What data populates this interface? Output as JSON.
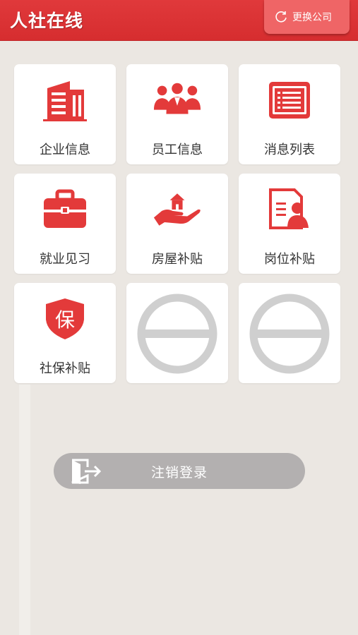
{
  "header": {
    "title": "人社在线",
    "switch_company_label": "更换公司",
    "accent_color": "#d8302f"
  },
  "grid": {
    "items": [
      {
        "label": "企业信息",
        "icon": "building-icon"
      },
      {
        "label": "员工信息",
        "icon": "staff-group-icon"
      },
      {
        "label": "消息列表",
        "icon": "message-list-icon"
      },
      {
        "label": "就业见习",
        "icon": "briefcase-icon"
      },
      {
        "label": "房屋补贴",
        "icon": "house-in-hand-icon"
      },
      {
        "label": "岗位补贴",
        "icon": "resume-person-icon"
      },
      {
        "label": "社保补贴",
        "icon": "shield-bao-icon",
        "icon_text": "保"
      },
      {
        "label": "",
        "icon": "placeholder-circle-icon"
      },
      {
        "label": "",
        "icon": "placeholder-circle-icon"
      }
    ]
  },
  "logout": {
    "label": "注销登录",
    "icon": "exit-door-icon"
  }
}
